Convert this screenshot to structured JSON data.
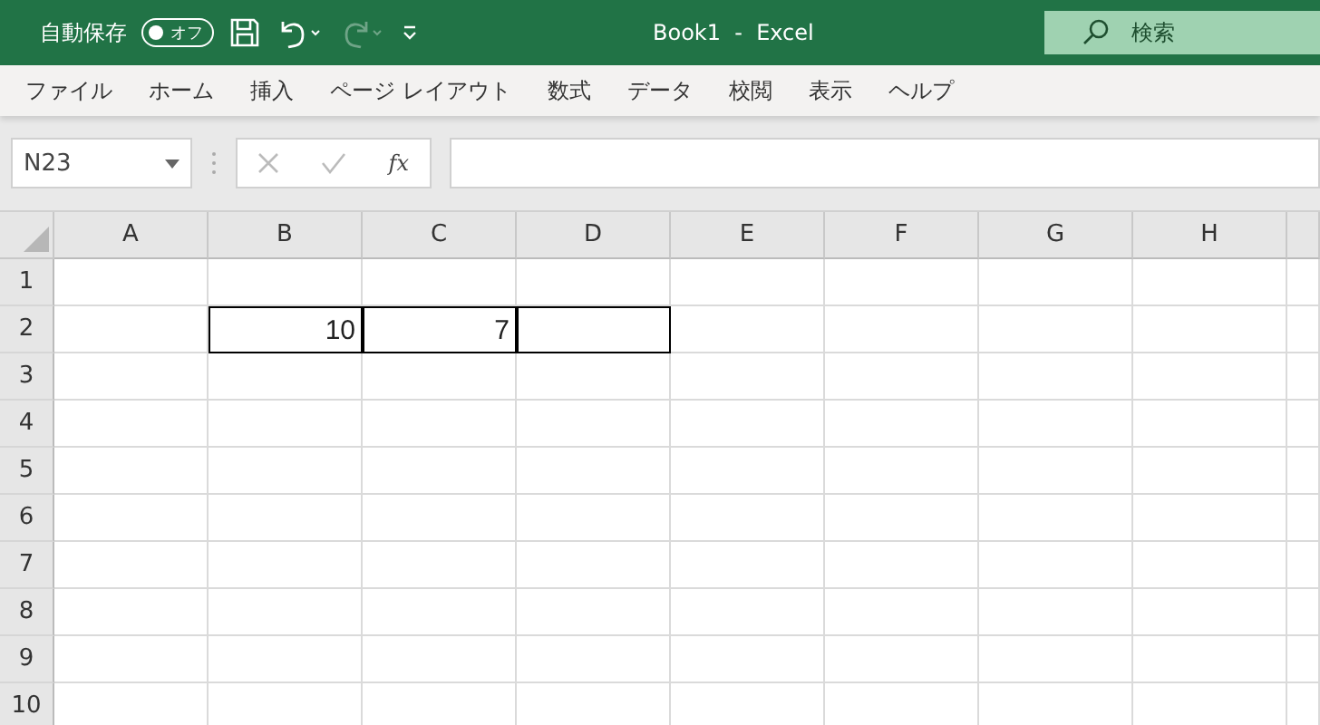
{
  "title_bar": {
    "autosave": {
      "label": "自動保存",
      "on": false,
      "state_text": "オフ"
    },
    "redo_disabled": true,
    "title": "Book1  -  Excel",
    "search": {
      "placeholder": "検索"
    }
  },
  "ribbon_tabs": [
    {
      "label": "ファイル"
    },
    {
      "label": "ホーム"
    },
    {
      "label": "挿入"
    },
    {
      "label": "ページ レイアウト"
    },
    {
      "label": "数式"
    },
    {
      "label": "データ"
    },
    {
      "label": "校閲"
    },
    {
      "label": "表示"
    },
    {
      "label": "ヘルプ"
    }
  ],
  "formula_bar": {
    "name_box": "N23",
    "fx": "fx"
  },
  "sheet": {
    "columns": [
      "A",
      "B",
      "C",
      "D",
      "E",
      "F",
      "G",
      "H"
    ],
    "rows": [
      {
        "label": "1"
      },
      {
        "label": "2",
        "cells": [
          {
            "bordered": false
          },
          {
            "value": "10",
            "bordered": true
          },
          {
            "value": "7",
            "bordered": true
          },
          {
            "bordered": true
          }
        ]
      },
      {
        "label": "3"
      },
      {
        "label": "4"
      },
      {
        "label": "5"
      },
      {
        "label": "6"
      },
      {
        "label": "7"
      },
      {
        "label": "8"
      },
      {
        "label": "9"
      },
      {
        "label": "10"
      }
    ]
  }
}
